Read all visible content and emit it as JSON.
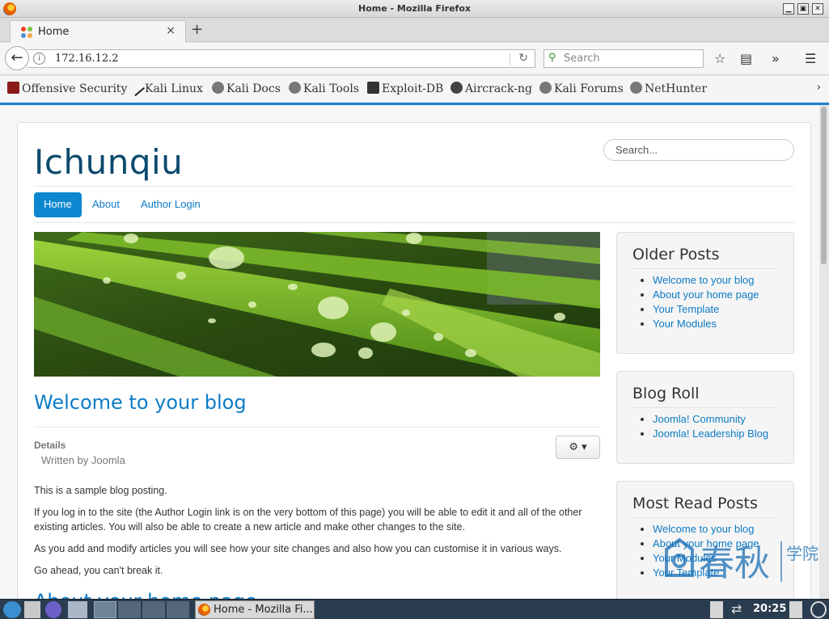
{
  "window": {
    "title": "Home - Mozilla Firefox"
  },
  "tabs": [
    {
      "label": "Home"
    }
  ],
  "navbar": {
    "url": "172.16.12.2",
    "search_placeholder": "Search"
  },
  "bookmarks": [
    {
      "label": "Offensive Security",
      "icon": "offsec-icon"
    },
    {
      "label": "Kali Linux",
      "icon": "kali-icon"
    },
    {
      "label": "Kali Docs",
      "icon": "globe-icon"
    },
    {
      "label": "Kali Tools",
      "icon": "globe-icon"
    },
    {
      "label": "Exploit-DB",
      "icon": "exploitdb-icon"
    },
    {
      "label": "Aircrack-ng",
      "icon": "aircrack-icon"
    },
    {
      "label": "Kali Forums",
      "icon": "globe-icon"
    },
    {
      "label": "NetHunter",
      "icon": "globe-icon"
    }
  ],
  "site": {
    "brand": "Ichunqiu",
    "search_placeholder": "Search...",
    "nav": [
      "Home",
      "About",
      "Author Login"
    ],
    "article": {
      "title": "Welcome to your blog",
      "details_label": "Details",
      "written_by": "Written by Joomla",
      "paragraphs": [
        "This is a sample blog posting.",
        "If you log in to the site (the Author Login link is on the very bottom of this page) you will be able to edit it and all of the other existing articles. You will also be able to create a new article and make other changes to the site.",
        "As you add and modify articles you will see how your site changes and also how you can customise it in various ways.",
        "Go ahead, you can't break it."
      ]
    },
    "next_article_title": "About your home page",
    "modules": [
      {
        "title": "Older Posts",
        "links": [
          "Welcome to your blog",
          "About your home page",
          "Your Template",
          "Your Modules"
        ]
      },
      {
        "title": "Blog Roll",
        "links": [
          "Joomla! Community",
          "Joomla! Leadership Blog"
        ]
      },
      {
        "title": "Most Read Posts",
        "links": [
          "Welcome to your blog",
          "About your home page",
          "Your Modules",
          "Your Template"
        ]
      }
    ]
  },
  "watermark": {
    "text1": "春秋",
    "text2": "学院"
  },
  "taskbar": {
    "task_label": "Home - Mozilla Fi...",
    "clock": "20:25"
  },
  "colors": {
    "accent": "#0d87d0",
    "link": "#0d7bc5",
    "brand": "#0c4a6e",
    "taskbar": "#2a3c4f"
  }
}
